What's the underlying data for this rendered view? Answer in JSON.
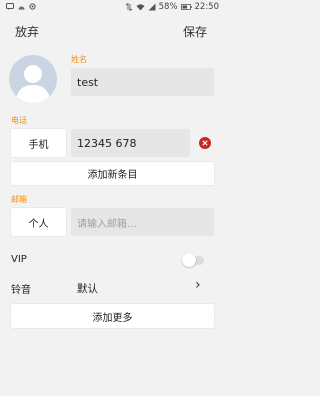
{
  "status_bar": {
    "battery": "58%",
    "time": "22:50"
  },
  "top_bar": {
    "cancel_label": "放弃",
    "save_label": "保存"
  },
  "name": {
    "label": "姓名",
    "value": "test"
  },
  "phone": {
    "section_label": "电话",
    "type_label": "手机",
    "value": "12345 678",
    "add_entry_label": "添加新条目"
  },
  "email": {
    "section_label": "邮箱",
    "type_label": "个人",
    "placeholder": "请输入邮箱..."
  },
  "vip": {
    "label": "VIP",
    "enabled": false
  },
  "ringtone": {
    "label": "铃音",
    "value": "默认",
    "chevron": "›"
  },
  "more": {
    "add_more_label": "添加更多"
  },
  "colors": {
    "accent": "#ff8a00",
    "remove": "#c62828",
    "background": "#f2f2f2"
  }
}
